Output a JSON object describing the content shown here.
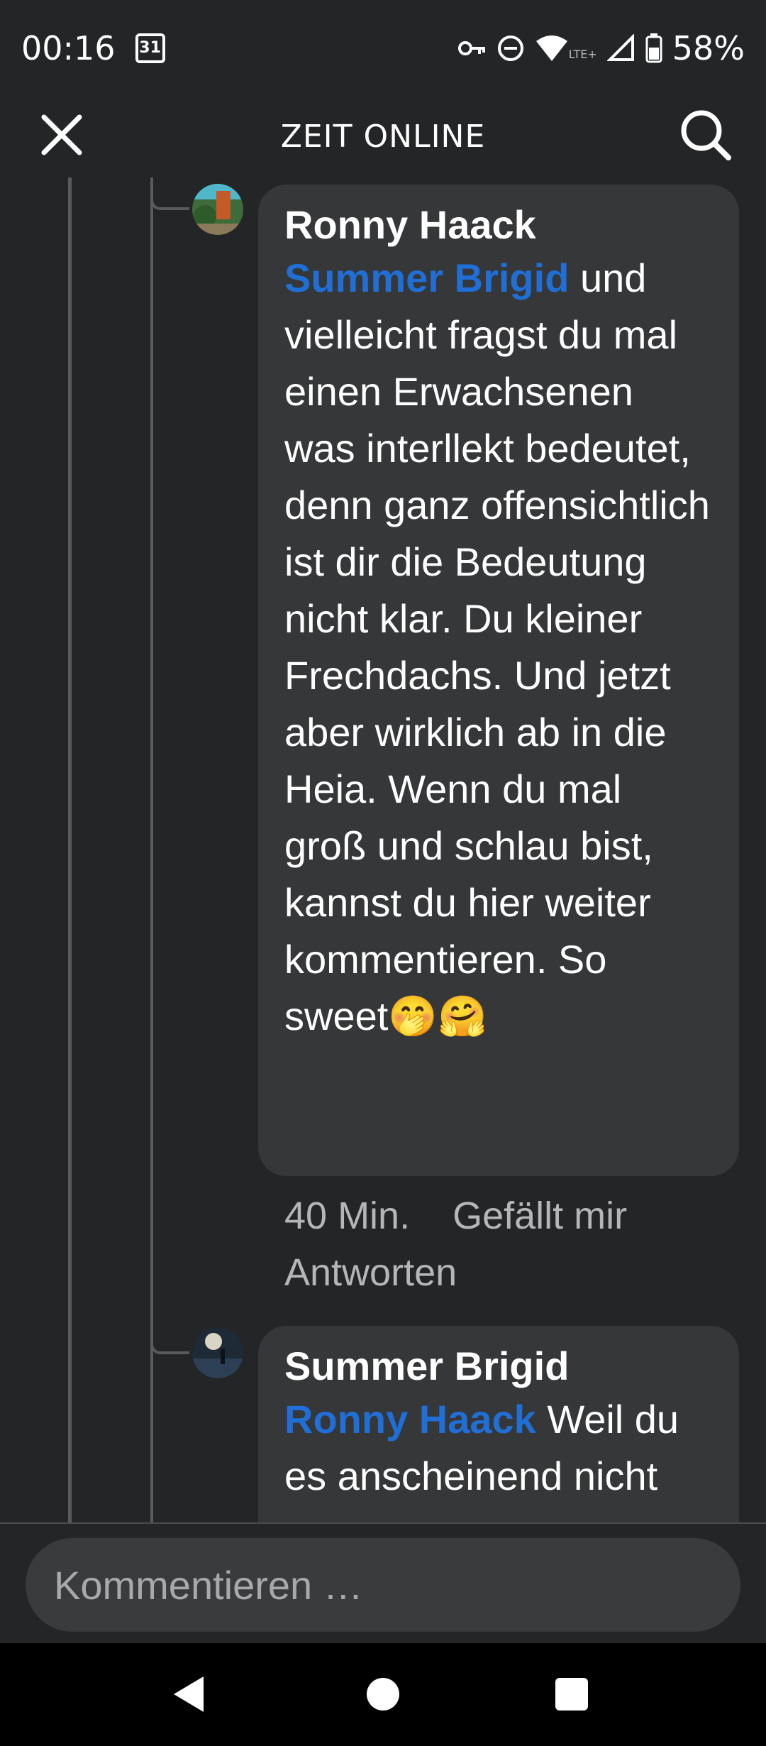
{
  "status_bar": {
    "time": "00:16",
    "calendar_day": "31",
    "network_label": "LTE+",
    "battery": "58%"
  },
  "header": {
    "title": "ZEIT ONLINE"
  },
  "comments": [
    {
      "author": "Ronny Haack",
      "mention": "Summer Brigid",
      "text": " und vielleicht fragst du mal einen Erwachsenen was interllekt bedeutet, denn ganz offensichtlich ist dir die Bedeutung nicht klar. Du kleiner Frechdachs. Und jetzt aber wirklich ab in die Heia. Wenn du mal groß und schlau bist, kannst du hier weiter kommentieren. So sweet🤭🤗",
      "time": "40 Min.",
      "like_label": "Gefällt mir",
      "reply_label": "Antworten"
    },
    {
      "author": "Summer Brigid",
      "mention": "Ronny Haack",
      "text": " Weil du es anscheinend nicht"
    }
  ],
  "composer": {
    "placeholder": "Kommentieren …"
  },
  "icons": {
    "close": "close-icon",
    "search": "search-icon",
    "vpn": "key-icon",
    "dnd": "do-not-disturb-icon",
    "wifi": "wifi-icon",
    "signal": "signal-icon",
    "battery": "battery-icon"
  }
}
